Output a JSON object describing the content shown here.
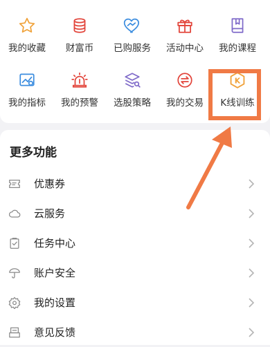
{
  "grid": {
    "items": [
      {
        "label": "我的收藏",
        "icon": "star-icon"
      },
      {
        "label": "财富币",
        "icon": "coin-stack-icon"
      },
      {
        "label": "已购服务",
        "icon": "heart-hands-icon"
      },
      {
        "label": "活动中心",
        "icon": "gift-icon"
      },
      {
        "label": "我的课程",
        "icon": "book-icon"
      },
      {
        "label": "我的指标",
        "icon": "chart-indicator-icon"
      },
      {
        "label": "我的预警",
        "icon": "alarm-light-icon"
      },
      {
        "label": "选股策略",
        "icon": "layers-search-icon"
      },
      {
        "label": "我的交易",
        "icon": "exchange-icon"
      },
      {
        "label": "K线训练",
        "icon": "k-hexagon-icon",
        "badge_letter": "K"
      }
    ]
  },
  "more": {
    "title": "更多功能",
    "items": [
      {
        "label": "优惠券",
        "icon": "coupon-icon"
      },
      {
        "label": "云服务",
        "icon": "cloud-icon"
      },
      {
        "label": "任务中心",
        "icon": "clipboard-check-icon"
      },
      {
        "label": "账户安全",
        "icon": "umbrella-icon"
      },
      {
        "label": "我的设置",
        "icon": "gear-icon"
      },
      {
        "label": "意见反馈",
        "icon": "feedback-icon"
      }
    ]
  },
  "colors": {
    "accent_orange": "#f07a45",
    "icon_orange": "#f0a23a",
    "icon_red": "#e2443a",
    "icon_blue": "#3c8ddf",
    "icon_purple": "#7f6ac9",
    "icon_gray": "#8a8a8a"
  }
}
